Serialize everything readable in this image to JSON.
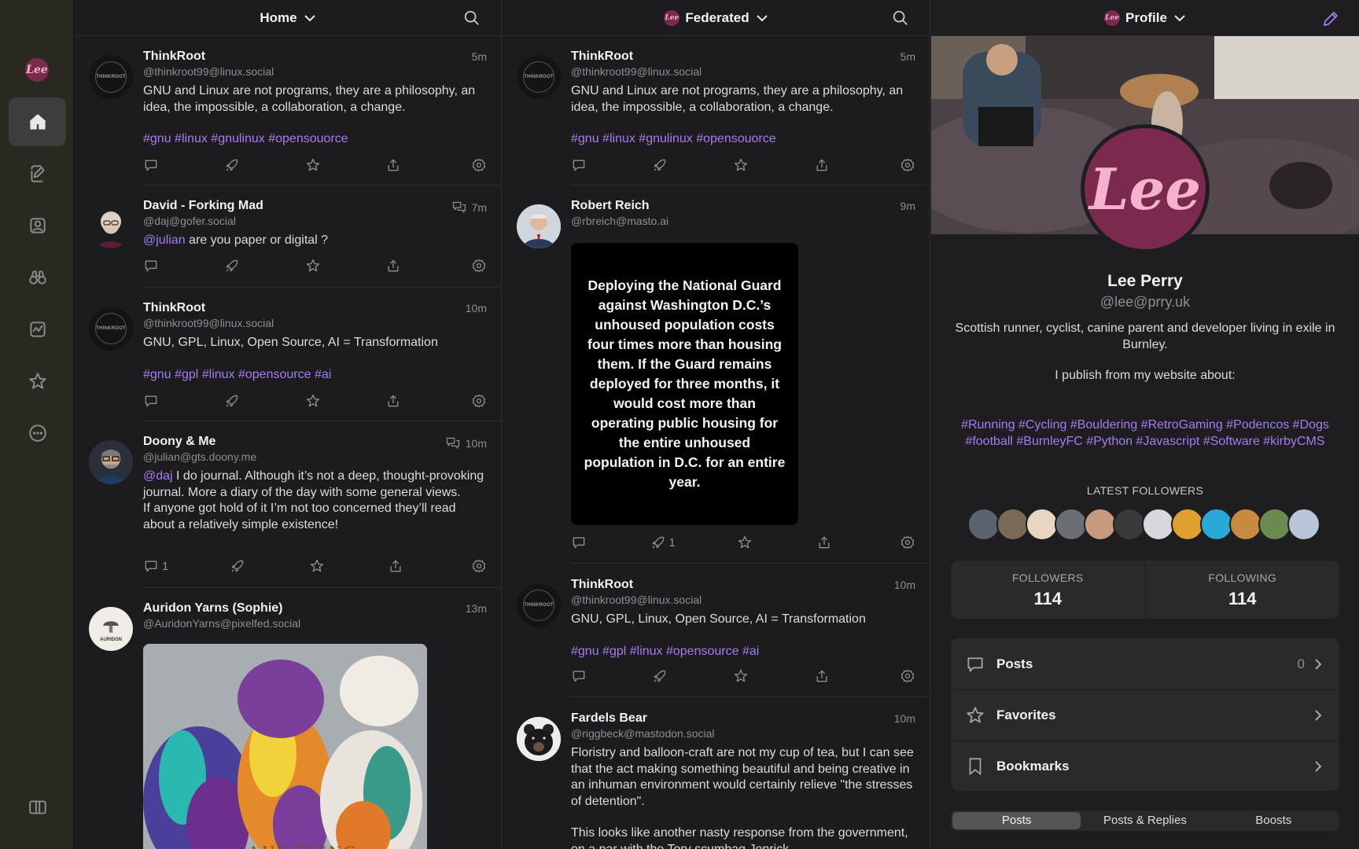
{
  "sidebar": {
    "avatar_text": "Lee",
    "items": [
      "home",
      "compose",
      "profile",
      "explore",
      "activity",
      "favorites",
      "more"
    ]
  },
  "home": {
    "title": "Home",
    "posts": [
      {
        "name": "ThinkRoot",
        "handle": "@thinkroot99@linux.social",
        "time": "5m",
        "text": "GNU and Linux are not programs, they are a philosophy, an idea, the impossible, a collaboration, a change.",
        "tags": "#gnu #linux #gnulinux #opensouorce",
        "avatar_text": "THINKROOT"
      },
      {
        "name": "David - Forking Mad",
        "handle": "@daj@gofer.social",
        "time": "7m",
        "mention": "@julian",
        "text": " are you paper or digital ?"
      },
      {
        "name": "ThinkRoot",
        "handle": "@thinkroot99@linux.social",
        "time": "10m",
        "text": "GNU, GPL, Linux, Open Source, AI = Transformation",
        "tags": "#gnu #gpl #linux #opensource #ai",
        "avatar_text": "THINKROOT"
      },
      {
        "name": "Doony & Me",
        "handle": "@julian@gts.doony.me",
        "time": "10m",
        "mention": "@daj",
        "text": " I do journal. Although it’s not a deep, thought-provoking journal. More a diary of the day with some general views.",
        "text2": "If anyone got hold of it I’m not too concerned they’ll read about a relatively simple existence!",
        "replies": "1"
      },
      {
        "name": "Auridon Yarns (Sophie)",
        "handle": "@AuridonYarns@pixelfed.social",
        "time": "13m",
        "avatar_text": "AURIDON",
        "image_caption": "LAUNCHING"
      }
    ]
  },
  "federated": {
    "title": "Federated",
    "avatar_text": "Lee",
    "posts": [
      {
        "name": "ThinkRoot",
        "handle": "@thinkroot99@linux.social",
        "time": "5m",
        "text": "GNU and Linux are not programs, they are a philosophy, an idea, the impossible, a collaboration, a change.",
        "tags": "#gnu #linux #gnulinux #opensouorce",
        "avatar_text": "THINKROOT"
      },
      {
        "name": "Robert Reich",
        "handle": "@rbreich@masto.ai",
        "time": "9m",
        "card_text": "Deploying the National Guard against Washington D.C.’s unhoused population costs four times more than housing them. If the Guard remains deployed for three months, it would cost more than operating public housing for the entire unhoused population in D.C. for an entire year.",
        "boosts": "1"
      },
      {
        "name": "ThinkRoot",
        "handle": "@thinkroot99@linux.social",
        "time": "10m",
        "text": "GNU, GPL, Linux, Open Source, AI = Transformation",
        "tags": "#gnu #gpl #linux #opensource #ai",
        "avatar_text": "THINKROOT"
      },
      {
        "name": "Fardels Bear",
        "handle": "@riggbeck@mastodon.social",
        "time": "10m",
        "text": "Floristry and balloon-craft are not my cup of tea, but I can see that the act making something beautiful and being creative in an inhuman environment would certainly relieve \"the stresses of detention\".",
        "text2": "This looks like another nasty response from the government, on a par with the Tory scumbag Jenrick"
      }
    ]
  },
  "profile": {
    "title": "Profile",
    "avatar_text": "Lee",
    "name": "Lee Perry",
    "handle": "@lee@prry.uk",
    "bio": "Scottish runner, cyclist, canine parent and developer living in exile in Burnley.",
    "bio2": "I publish from my website about:",
    "tags": "#Running #Cycling #Bouldering #RetroGaming #Podencos #Dogs #football #BurnleyFC #Python #Javascript #Software #kirbyCMS",
    "latest_followers_label": "LATEST FOLLOWERS",
    "follower_colors": [
      "#5a6470",
      "#7a6a55",
      "#e8d6c0",
      "#6b6f75",
      "#c79a80",
      "#3a3a3c",
      "#d8d8dc",
      "#e0a030",
      "#2aa8d8",
      "#c88a40",
      "#6a8a50",
      "#b8c4d8"
    ],
    "followers_label": "FOLLOWERS",
    "followers": "114",
    "following_label": "FOLLOWING",
    "following": "114",
    "menu": [
      {
        "label": "Posts",
        "count": "0"
      },
      {
        "label": "Favorites",
        "count": ""
      },
      {
        "label": "Bookmarks",
        "count": ""
      }
    ],
    "tabs": [
      "Posts",
      "Posts & Replies",
      "Boosts"
    ]
  },
  "colors": {
    "accent": "#a57cf0",
    "fab": "#7e4ee6",
    "avatar_brand": "#7b2a4e"
  }
}
